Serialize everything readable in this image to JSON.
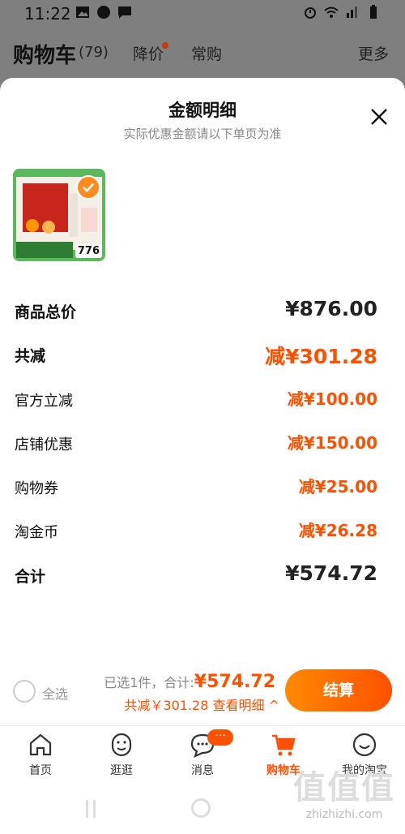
{
  "status_bar": {
    "time": "11:22"
  },
  "cart_header": {
    "title": "购物车",
    "count": "(79)",
    "tabs": [
      "降价",
      "常购"
    ],
    "more": "更多"
  },
  "sheet": {
    "title": "金额明细",
    "subtitle": "实际优惠金额请以下单页为准",
    "thumb_price": "776",
    "rows": [
      {
        "label": "商品总价",
        "value": "¥876.00"
      },
      {
        "label": "共减",
        "value": "减¥301.28"
      },
      {
        "label": "官方立减",
        "value": "减¥100.00"
      },
      {
        "label": "店铺优惠",
        "value": "减¥150.00"
      },
      {
        "label": "购物券",
        "value": "减¥25.00"
      },
      {
        "label": "淘金币",
        "value": "减¥26.28"
      },
      {
        "label": "合计",
        "value": "¥574.72"
      }
    ]
  },
  "checkout_bar": {
    "select_all": "全选",
    "selected_text": "已选1件，合计:",
    "total": "¥574.72",
    "discount_text": "共减￥301.28",
    "view_detail": "查看明细 ^",
    "checkout_label": "结算"
  },
  "tab_bar": {
    "badge": "···",
    "tabs": [
      {
        "label": "首页"
      },
      {
        "label": "逛逛"
      },
      {
        "label": "消息"
      },
      {
        "label": "购物车"
      },
      {
        "label": "我的淘宝"
      }
    ]
  },
  "watermark": {
    "big": "值值值",
    "site": "zhizhizhi.com"
  },
  "colors": {
    "accent": "#ff5000",
    "overlay": "#7f7f7f"
  }
}
